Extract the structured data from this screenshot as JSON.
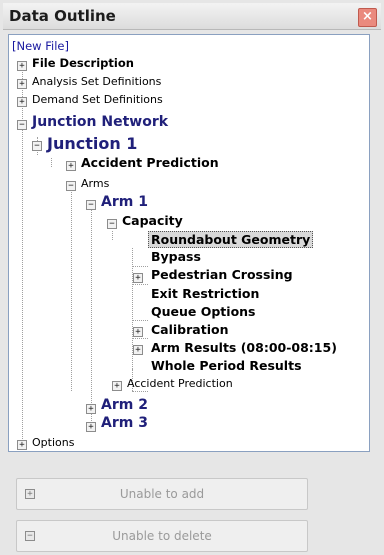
{
  "window": {
    "title": "Data Outline",
    "close_glyph": "×"
  },
  "tree": {
    "new_file": "[New File]",
    "file_description": "File Description",
    "analysis_sets": "Analysis Set Definitions",
    "demand_sets": "Demand Set Definitions",
    "junction_network": "Junction Network",
    "junction_1": "Junction 1",
    "j_accident_prediction": "Accident Prediction",
    "arms": "Arms",
    "arm_1": "Arm 1",
    "capacity": "Capacity",
    "roundabout_geometry": "Roundabout Geometry",
    "bypass": "Bypass",
    "pedestrian_crossing": "Pedestrian Crossing",
    "exit_restriction": "Exit Restriction",
    "queue_options": "Queue Options",
    "calibration": "Calibration",
    "arm_results": "Arm Results (08:00-08:15)",
    "whole_period_results": "Whole Period Results",
    "arm_accident_prediction": "Accident Prediction",
    "arm_2": "Arm 2",
    "arm_3": "Arm 3",
    "options": "Options",
    "plus": "+",
    "minus": "−"
  },
  "buttons": {
    "add_label": "Unable to add",
    "delete_label": "Unable to delete",
    "add_icon": "+",
    "delete_icon": "−"
  },
  "selected_item": "Roundabout Geometry"
}
